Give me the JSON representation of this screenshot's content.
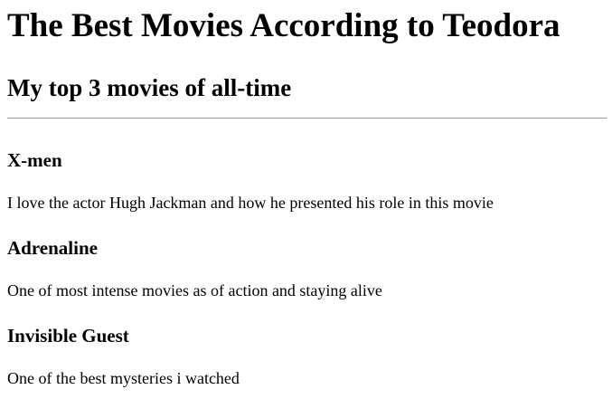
{
  "page": {
    "title": "The Best Movies According to Teodora",
    "subtitle": "My top 3 movies of all-time"
  },
  "movies": [
    {
      "name": "X-men",
      "description": "I love the actor Hugh Jackman and how he presented his role in this movie"
    },
    {
      "name": "Adrenaline",
      "description": "One of most intense movies as of action and staying alive"
    },
    {
      "name": "Invisible Guest",
      "description": "One of the best mysteries i watched"
    }
  ],
  "colors": {
    "text": "#000000",
    "background": "#ffffff",
    "divider": "#9a9a9a"
  }
}
